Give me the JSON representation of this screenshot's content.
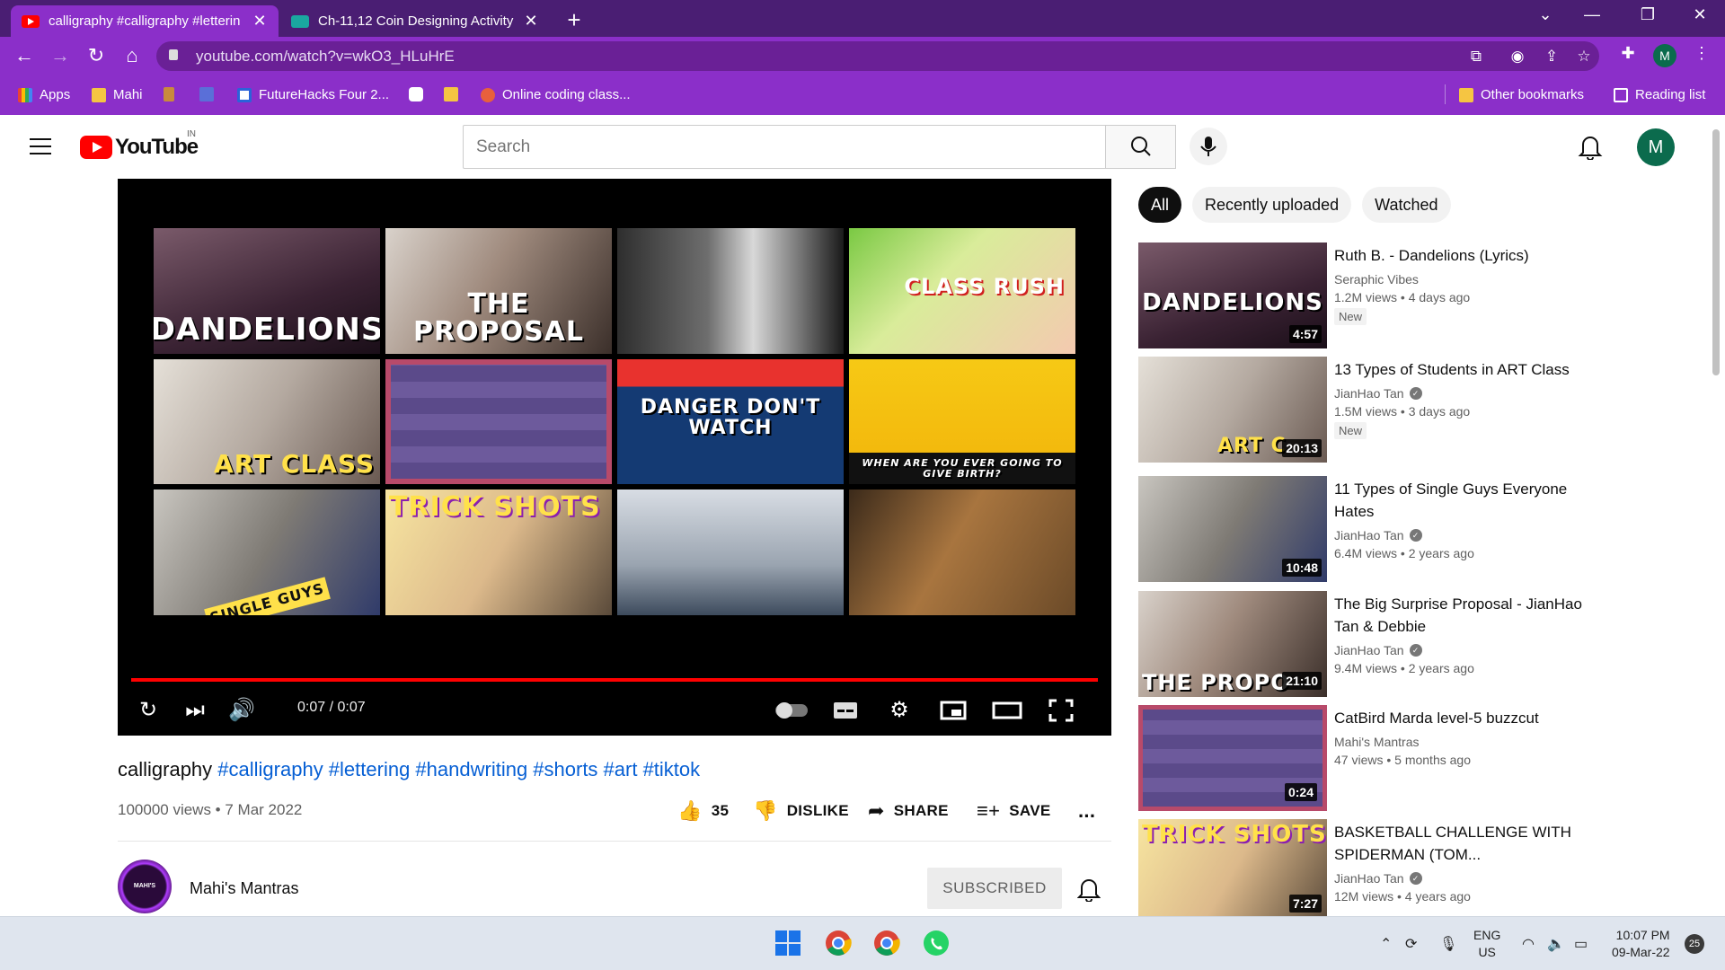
{
  "browser": {
    "tabs": [
      {
        "title": "calligraphy #calligraphy #letterin",
        "close": "✕"
      },
      {
        "title": "Ch-11,12 Coin Designing Activity",
        "close": "✕"
      }
    ],
    "new_tab": "+",
    "url": "youtube.com/watch?v=wkO3_HLuHrE",
    "profile_initial": "M",
    "bookmarks": [
      {
        "label": "Apps"
      },
      {
        "label": "Mahi"
      },
      {
        "label": "FutureHacks Four 2..."
      },
      {
        "label": "Online coding class..."
      }
    ],
    "other_bookmarks": "Other bookmarks",
    "reading_list": "Reading list"
  },
  "youtube": {
    "logo_text": "YouTube",
    "region": "IN",
    "search_placeholder": "Search",
    "avatar_initial": "M"
  },
  "player": {
    "time": "0:07 / 0:07",
    "progress": 1.0,
    "grid_overlays": [
      "DANDELIONS",
      "THE PROPOSAL",
      "",
      "CLASS RUSH",
      "ART CLASS",
      "",
      "DANGER DON'T WATCH",
      "WHEN ARE YOU EVER GOING TO GIVE BIRTH?",
      "SINGLE GUYS",
      "TRICK SHOTS",
      "",
      ""
    ]
  },
  "video": {
    "title_plain": "calligraphy",
    "title_tags": "#calligraphy #lettering #handwriting #shorts #art #tiktok",
    "views_date": "100000 views • 7 Mar 2022",
    "likes": "35",
    "dislike": "DISLIKE",
    "share": "SHARE",
    "save": "SAVE",
    "more": "...",
    "channel": "Mahi's Mantras",
    "channel_avatar_text": "MAHI'S MANTRAS",
    "subscribed": "SUBSCRIBED"
  },
  "sidebar": {
    "chips": [
      "All",
      "Recently uploaded",
      "Watched"
    ],
    "recs": [
      {
        "title": "Ruth B. - Dandelions (Lyrics)",
        "channel": "Seraphic Vibes",
        "verified": false,
        "meta": "1.2M views • 4 days ago",
        "badge": "New",
        "duration": "4:57",
        "overlay": "DANDELIONS"
      },
      {
        "title": "13 Types of Students in ART Class",
        "channel": "JianHao Tan",
        "verified": true,
        "meta": "1.5M views • 3 days ago",
        "badge": "New",
        "duration": "20:13",
        "overlay": "ART C"
      },
      {
        "title": "11 Types of Single Guys Everyone Hates",
        "channel": "JianHao Tan",
        "verified": true,
        "meta": "6.4M views • 2 years ago",
        "badge": "",
        "duration": "10:48",
        "overlay": ""
      },
      {
        "title": "The Big Surprise Proposal - JianHao Tan & Debbie",
        "channel": "JianHao Tan",
        "verified": true,
        "meta": "9.4M views • 2 years ago",
        "badge": "",
        "duration": "21:10",
        "overlay": "THE PROPO"
      },
      {
        "title": "CatBird Marda level-5 buzzcut",
        "channel": "Mahi's Mantras",
        "verified": false,
        "meta": "47 views • 5 months ago",
        "badge": "",
        "duration": "0:24",
        "overlay": ""
      },
      {
        "title": "BASKETBALL CHALLENGE WITH SPIDERMAN (TOM...",
        "channel": "JianHao Tan",
        "verified": true,
        "meta": "12M views • 4 years ago",
        "badge": "",
        "duration": "7:27",
        "overlay": "TRICK SHOTS"
      }
    ]
  },
  "taskbar": {
    "lang_line1": "ENG",
    "lang_line2": "US",
    "time": "10:07 PM",
    "date": "09-Mar-22",
    "notifications": "25"
  },
  "colors": {
    "tabbar": "#4a1e73",
    "toolbar": "#8b2fc9",
    "yt_red": "#ff0000",
    "link_blue": "#065fd4"
  }
}
